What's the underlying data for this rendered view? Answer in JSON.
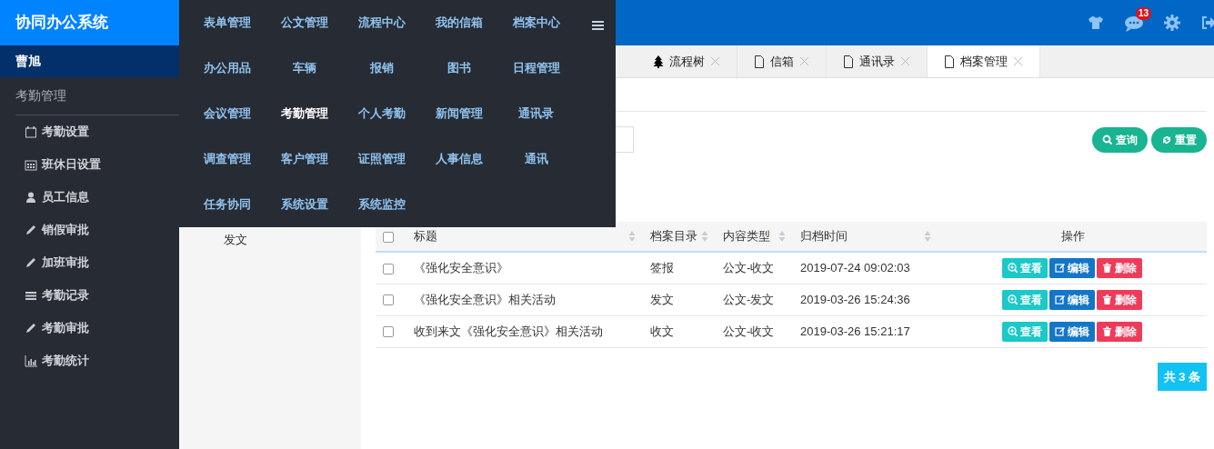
{
  "app": {
    "title": "协同办公系统",
    "user": "曹旭"
  },
  "sidebar": {
    "section": "考勤管理",
    "items": [
      {
        "label": "考勤设置"
      },
      {
        "label": "班休日设置"
      },
      {
        "label": "员工信息"
      },
      {
        "label": "销假审批"
      },
      {
        "label": "加班审批"
      },
      {
        "label": "考勤记录"
      },
      {
        "label": "考勤审批"
      },
      {
        "label": "考勤统计"
      }
    ]
  },
  "mega_menu": {
    "items": [
      {
        "label": "表单管理",
        "selected": false
      },
      {
        "label": "公文管理",
        "selected": false
      },
      {
        "label": "流程中心",
        "selected": false
      },
      {
        "label": "我的信箱",
        "selected": false
      },
      {
        "label": "档案中心",
        "selected": false
      },
      {
        "label": "办公用品",
        "selected": false
      },
      {
        "label": "车辆",
        "selected": false
      },
      {
        "label": "报销",
        "selected": false
      },
      {
        "label": "图书",
        "selected": false
      },
      {
        "label": "日程管理",
        "selected": false
      },
      {
        "label": "会议管理",
        "selected": false
      },
      {
        "label": "考勤管理",
        "selected": true
      },
      {
        "label": "个人考勤",
        "selected": false
      },
      {
        "label": "新闻管理",
        "selected": false
      },
      {
        "label": "通讯录",
        "selected": false
      },
      {
        "label": "调查管理",
        "selected": false
      },
      {
        "label": "客户管理",
        "selected": false
      },
      {
        "label": "证照管理",
        "selected": false
      },
      {
        "label": "人事信息",
        "selected": false
      },
      {
        "label": "通讯",
        "selected": false
      },
      {
        "label": "任务协同",
        "selected": false
      },
      {
        "label": "系统设置",
        "selected": false
      },
      {
        "label": "系统监控",
        "selected": false
      }
    ]
  },
  "topbar": {
    "message_count": "13"
  },
  "tabs": [
    {
      "label": "流程树",
      "selected": false
    },
    {
      "label": "信箱",
      "selected": false
    },
    {
      "label": "通讯录",
      "selected": false
    },
    {
      "label": "档案管理",
      "selected": true
    }
  ],
  "tree_panel": {
    "item": "发文"
  },
  "search": {
    "buttons": [
      "查询",
      "重置"
    ]
  },
  "table": {
    "header_checked": false,
    "columns": [
      {
        "label": "标题",
        "sortable": true
      },
      {
        "label": "档案目录",
        "sortable": true
      },
      {
        "label": "内容类型",
        "sortable": true
      },
      {
        "label": "归档时间",
        "sortable": true
      },
      {
        "label": "操作",
        "sortable": false
      }
    ],
    "rows": [
      {
        "checked": false,
        "cells": [
          "《强化安全意识》",
          "签报",
          "公文-收文",
          "2019-07-24 09:02:03"
        ],
        "actions": [
          "查看",
          "编辑",
          "删除"
        ]
      },
      {
        "checked": false,
        "cells": [
          "《强化安全意识》相关活动",
          "发文",
          "公文-发文",
          "2019-03-26 15:24:36"
        ],
        "actions": [
          "查看",
          "编辑",
          "删除"
        ]
      },
      {
        "checked": false,
        "cells": [
          "收到来文《强化安全意识》相关活动",
          "收文",
          "公文-收文",
          "2019-03-26 15:21:17"
        ],
        "actions": [
          "查看",
          "编辑",
          "删除"
        ]
      }
    ]
  },
  "pagination": {
    "total": "共 3 条"
  }
}
